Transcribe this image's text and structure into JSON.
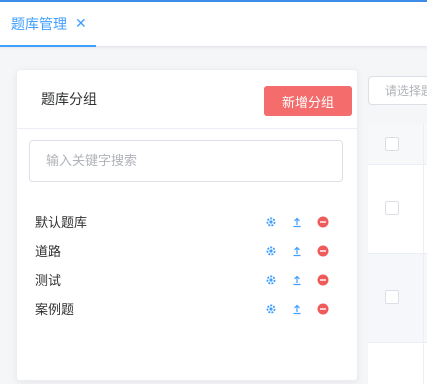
{
  "tabs": [
    {
      "label": "题库管理",
      "close_icon": "close-icon"
    }
  ],
  "panel": {
    "title": "题库分组",
    "add_button": "新增分组",
    "search_placeholder": "输入关键字搜索",
    "groups": [
      {
        "name": "默认题库"
      },
      {
        "name": "道路"
      },
      {
        "name": "测试"
      },
      {
        "name": "案例题"
      }
    ],
    "action_icons": [
      "settings-icon",
      "upload-icon",
      "remove-icon"
    ]
  },
  "right": {
    "select_placeholder": "请选择题"
  },
  "colors": {
    "accent": "#409eff",
    "danger": "#f56c6c",
    "remove_icon": "#ef5b5b",
    "border": "#dcdfe6"
  }
}
